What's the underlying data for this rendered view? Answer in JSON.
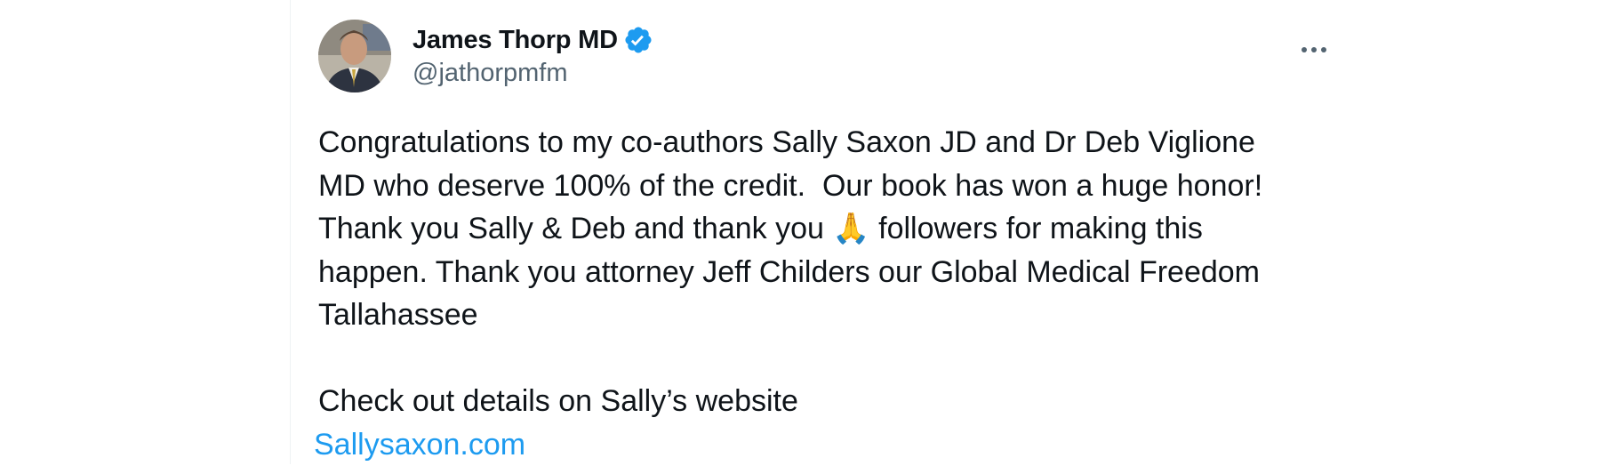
{
  "tweet": {
    "author": {
      "display_name": "James Thorp MD",
      "handle": "@jathorpmfm",
      "verified": true,
      "verified_color": "#1d9bf0"
    },
    "icons": {
      "verified": "verified-badge-icon",
      "more": "more-options-icon"
    },
    "body": {
      "line1": "Congratulations to my co-authors Sally Saxon JD and Dr Deb Viglione",
      "line2": "MD who deserve 100% of the credit.  Our book has won a huge honor!",
      "line3_pre": "Thank you Sally & Deb and thank you ",
      "line3_emoji": "🙏",
      "line3_post": " followers for making this",
      "line4": "happen. Thank you attorney Jeff Childers our Global Medical Freedom",
      "line5": "Tallahassee",
      "line6": "Check out details on Sally’s website"
    },
    "link": {
      "text": "Sallysaxon.com",
      "color": "#1d9bf0"
    }
  }
}
